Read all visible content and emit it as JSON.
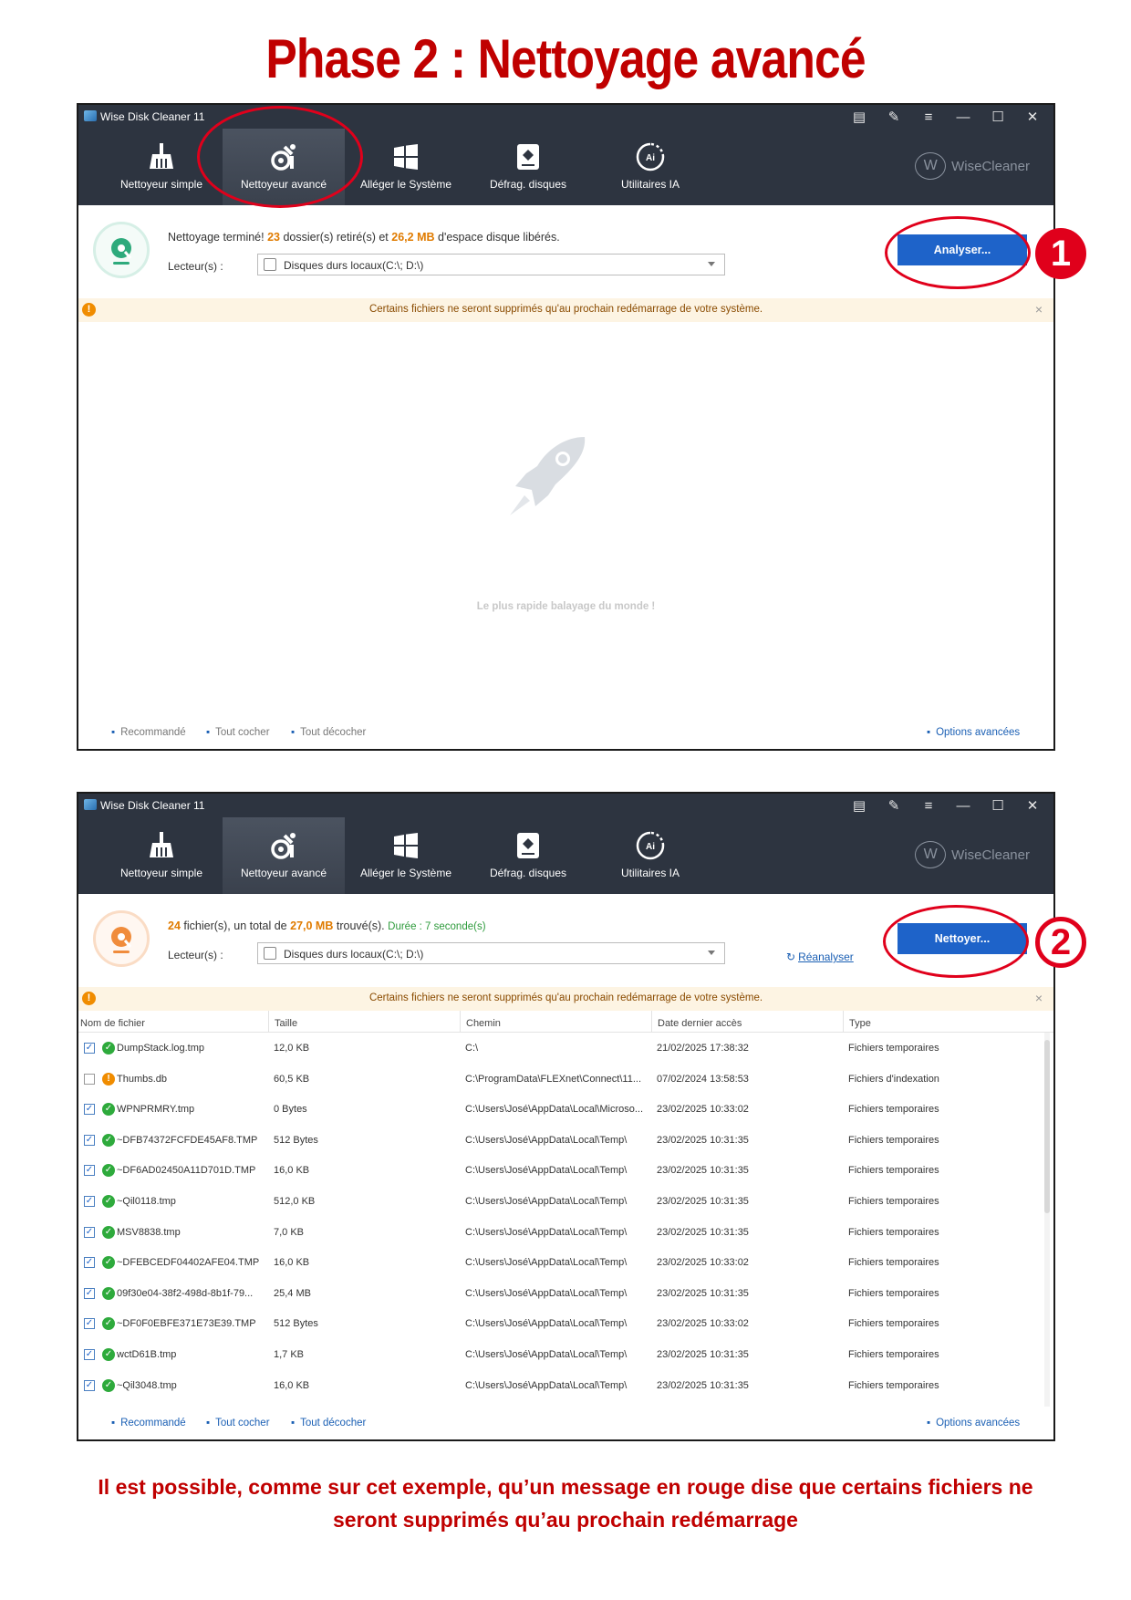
{
  "page": {
    "title": "Phase 2 : Nettoyage avancé",
    "caption": "Il est possible, comme sur cet exemple, qu’un message en rouge dise que certains fichiers ne seront supprimés qu’au prochain redémarrage"
  },
  "app": {
    "title": "Wise Disk Cleaner 11",
    "brand": "WiseCleaner",
    "brand_letter": "W",
    "tabs": [
      {
        "label": "Nettoyeur simple",
        "icon": "broom-icon"
      },
      {
        "label": "Nettoyeur avancé",
        "icon": "advanced-cleaner-icon"
      },
      {
        "label": "Alléger le Système",
        "icon": "windows-icon"
      },
      {
        "label": "Défrag. disques",
        "icon": "disk-defrag-icon"
      },
      {
        "label": "Utilitaires IA",
        "icon": "ai-utilities-icon"
      }
    ],
    "active_tab": "Nettoyeur avancé"
  },
  "screen1": {
    "summary": {
      "prefix": "Nettoyage terminé!",
      "folders": "23",
      "folders_text": "dossier(s) retiré(s) et",
      "size": "26,2 MB",
      "size_text": "d'espace disque libérés."
    },
    "drive_label": "Lecteur(s) :",
    "drive_value": "Disques durs locaux(C:\\; D:\\)",
    "primary_button": "Analyser...",
    "notice": "Certains fichiers ne seront supprimés qu'au prochain redémarrage de votre système.",
    "empty_text": "Le plus rapide balayage du monde !",
    "footer": {
      "recommended": "Recommandé",
      "check_all": "Tout cocher",
      "uncheck_all": "Tout décocher",
      "advanced": "Options avancées"
    },
    "badge": "1"
  },
  "screen2": {
    "summary": {
      "files": "24",
      "files_text": "fichier(s), un total de",
      "size": "27,0 MB",
      "size_text": "trouvé(s).",
      "duration": "Durée : 7 seconde(s)"
    },
    "drive_label": "Lecteur(s) :",
    "drive_value": "Disques durs locaux(C:\\; D:\\)",
    "reanalyze": "Réanalyser",
    "primary_button": "Nettoyer...",
    "notice": "Certains fichiers ne seront supprimés qu'au prochain redémarrage de votre système.",
    "columns": [
      "Nom de fichier",
      "Taille",
      "Chemin",
      "Date dernier accès",
      "Type"
    ],
    "rows": [
      {
        "checked": true,
        "status": "ok",
        "name": "DumpStack.log.tmp",
        "size": "12,0 KB",
        "path": "C:\\",
        "date": "21/02/2025 17:38:32",
        "type": "Fichiers temporaires"
      },
      {
        "checked": false,
        "status": "warn",
        "name": "Thumbs.db",
        "size": "60,5 KB",
        "path": "C:\\ProgramData\\FLEXnet\\Connect\\11...",
        "date": "07/02/2024 13:58:53",
        "type": "Fichiers d'indexation"
      },
      {
        "checked": true,
        "status": "ok",
        "name": "WPNPRMRY.tmp",
        "size": "0 Bytes",
        "path": "C:\\Users\\José\\AppData\\Local\\Microso...",
        "date": "23/02/2025 10:33:02",
        "type": "Fichiers temporaires"
      },
      {
        "checked": true,
        "status": "ok",
        "name": "~DFB74372FCFDE45AF8.TMP",
        "size": "512 Bytes",
        "path": "C:\\Users\\José\\AppData\\Local\\Temp\\",
        "date": "23/02/2025 10:31:35",
        "type": "Fichiers temporaires"
      },
      {
        "checked": true,
        "status": "ok",
        "name": "~DF6AD02450A11D701D.TMP",
        "size": "16,0 KB",
        "path": "C:\\Users\\José\\AppData\\Local\\Temp\\",
        "date": "23/02/2025 10:31:35",
        "type": "Fichiers temporaires"
      },
      {
        "checked": true,
        "status": "ok",
        "name": "~Qil0118.tmp",
        "size": "512,0 KB",
        "path": "C:\\Users\\José\\AppData\\Local\\Temp\\",
        "date": "23/02/2025 10:31:35",
        "type": "Fichiers temporaires"
      },
      {
        "checked": true,
        "status": "ok",
        "name": "MSV8838.tmp",
        "size": "7,0 KB",
        "path": "C:\\Users\\José\\AppData\\Local\\Temp\\",
        "date": "23/02/2025 10:31:35",
        "type": "Fichiers temporaires"
      },
      {
        "checked": true,
        "status": "ok",
        "name": "~DFEBCEDF04402AFE04.TMP",
        "size": "16,0 KB",
        "path": "C:\\Users\\José\\AppData\\Local\\Temp\\",
        "date": "23/02/2025 10:33:02",
        "type": "Fichiers temporaires"
      },
      {
        "checked": true,
        "status": "ok",
        "name": "09f30e04-38f2-498d-8b1f-79...",
        "size": "25,4 MB",
        "path": "C:\\Users\\José\\AppData\\Local\\Temp\\",
        "date": "23/02/2025 10:31:35",
        "type": "Fichiers temporaires"
      },
      {
        "checked": true,
        "status": "ok",
        "name": "~DF0F0EBFE371E73E39.TMP",
        "size": "512 Bytes",
        "path": "C:\\Users\\José\\AppData\\Local\\Temp\\",
        "date": "23/02/2025 10:33:02",
        "type": "Fichiers temporaires"
      },
      {
        "checked": true,
        "status": "ok",
        "name": "wctD61B.tmp",
        "size": "1,7 KB",
        "path": "C:\\Users\\José\\AppData\\Local\\Temp\\",
        "date": "23/02/2025 10:31:35",
        "type": "Fichiers temporaires"
      },
      {
        "checked": true,
        "status": "ok",
        "name": "~Qil3048.tmp",
        "size": "16,0 KB",
        "path": "C:\\Users\\José\\AppData\\Local\\Temp\\",
        "date": "23/02/2025 10:31:35",
        "type": "Fichiers temporaires"
      }
    ],
    "footer": {
      "recommended": "Recommandé",
      "check_all": "Tout cocher",
      "uncheck_all": "Tout décocher",
      "advanced": "Options avancées"
    },
    "badge": "2"
  },
  "colors": {
    "title_red": "#c00000",
    "annotation_red": "#e0001b",
    "toolbar_bg": "#2d3440",
    "primary_blue": "#1e63c9",
    "highlight_orange": "#e07b00",
    "notice_bg": "#fdf4e3"
  }
}
